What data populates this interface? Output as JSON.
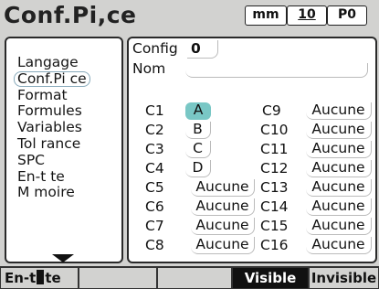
{
  "header": {
    "title": "Conf.Pi,ce",
    "unit": "mm",
    "resolution": "10",
    "program": "P0"
  },
  "menu": {
    "items": [
      {
        "label": "Langage",
        "selected": false
      },
      {
        "label": "Conf.Pi ce",
        "selected": true
      },
      {
        "label": "Format",
        "selected": false
      },
      {
        "label": "Formules",
        "selected": false
      },
      {
        "label": "Variables",
        "selected": false
      },
      {
        "label": "Tol rance",
        "selected": false
      },
      {
        "label": "SPC",
        "selected": false
      },
      {
        "label": "En-t te",
        "selected": false
      },
      {
        "label": "M moire",
        "selected": false
      }
    ],
    "scroll_icon": "down-arrow-icon"
  },
  "config": {
    "config_label": "Config",
    "config_value": "0",
    "name_label": "Nom",
    "name_value": ""
  },
  "channels": {
    "left": [
      {
        "label": "C1",
        "value": "A",
        "active": true
      },
      {
        "label": "C2",
        "value": "B",
        "active": false
      },
      {
        "label": "C3",
        "value": "C",
        "active": false
      },
      {
        "label": "C4",
        "value": "D",
        "active": false
      },
      {
        "label": "C5",
        "value": "Aucune",
        "active": false
      },
      {
        "label": "C6",
        "value": "Aucune",
        "active": false
      },
      {
        "label": "C7",
        "value": "Aucune",
        "active": false
      },
      {
        "label": "C8",
        "value": "Aucune",
        "active": false
      }
    ],
    "right": [
      {
        "label": "C9",
        "value": "Aucune"
      },
      {
        "label": "C10",
        "value": "Aucune"
      },
      {
        "label": "C11",
        "value": "Aucune"
      },
      {
        "label": "C12",
        "value": "Aucune"
      },
      {
        "label": "C13",
        "value": "Aucune"
      },
      {
        "label": "C14",
        "value": "Aucune"
      },
      {
        "label": "C15",
        "value": "Aucune"
      },
      {
        "label": "C16",
        "value": "Aucune"
      }
    ]
  },
  "softkeys": {
    "k1_pre": "En-t",
    "k1_post": "te",
    "k2": "",
    "k3": "",
    "k4": "Visible",
    "k5": "Invisible"
  },
  "colors": {
    "active_value": "#79c7c5",
    "panel_border": "#2a2a2a"
  }
}
